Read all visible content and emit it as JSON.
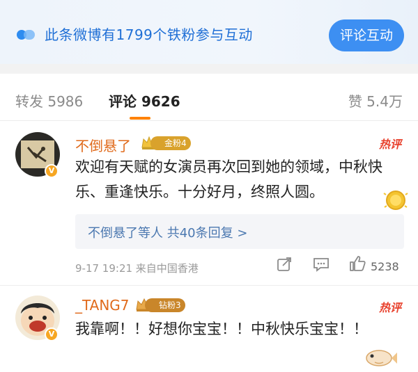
{
  "banner": {
    "text": "此条微博有1799个铁粉参与互动",
    "button": "评论互动",
    "colors": {
      "accent": "#1f6fd6",
      "button_bg": "#3d8ff2"
    }
  },
  "tabs": {
    "repost": "转发 5986",
    "comments": "评论 9626",
    "likes": "赞 5.4万",
    "active": "comments",
    "underline_color": "#ff8200"
  },
  "comments": [
    {
      "username": "不倒悬了",
      "fan_badge": "金粉4",
      "hot_label": "热评",
      "text": "欢迎有天赋的女演员再次回到她的领域，中秋快乐、重逢快乐。十分好月，终照人圆。",
      "replies": "不倒悬了等人 共40条回复 >",
      "timestamp": "9-17 19:21 来自中国香港",
      "like_count": "5238",
      "verified": true
    },
    {
      "username": "_TANG7",
      "fan_badge": "钻粉3",
      "hot_label": "热评",
      "text": "我靠啊！！好想你宝宝！！中秋快乐宝宝！！",
      "verified": true
    }
  ]
}
